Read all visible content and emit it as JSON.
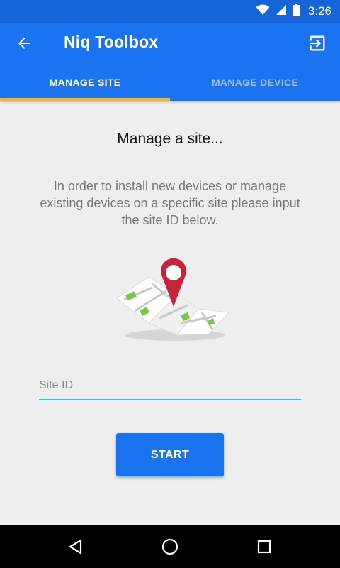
{
  "status_bar": {
    "time": "3:26"
  },
  "app_bar": {
    "title": "Niq Toolbox"
  },
  "tabs": [
    {
      "label": "MANAGE SITE",
      "active": true
    },
    {
      "label": "MANAGE DEVICE",
      "active": false
    }
  ],
  "content": {
    "heading": "Manage a site...",
    "description": "In order to install new devices or manage existing devices on a specific site please input the site ID below."
  },
  "site_input": {
    "placeholder": "Site ID",
    "value": ""
  },
  "start_button": {
    "label": "START"
  },
  "colors": {
    "app_bar": "#1a73f0",
    "status_bar": "#1565d8",
    "tab_indicator": "#f4b41a",
    "input_underline": "#27c7ea",
    "background": "#eeeeee"
  },
  "icons": {
    "back": "arrow-left-icon",
    "exit": "exit-to-app-icon",
    "wifi": "wifi-icon",
    "signal": "signal-icon",
    "battery": "battery-icon",
    "nav_back": "triangle-back-icon",
    "nav_home": "circle-home-icon",
    "nav_recents": "square-recents-icon"
  }
}
